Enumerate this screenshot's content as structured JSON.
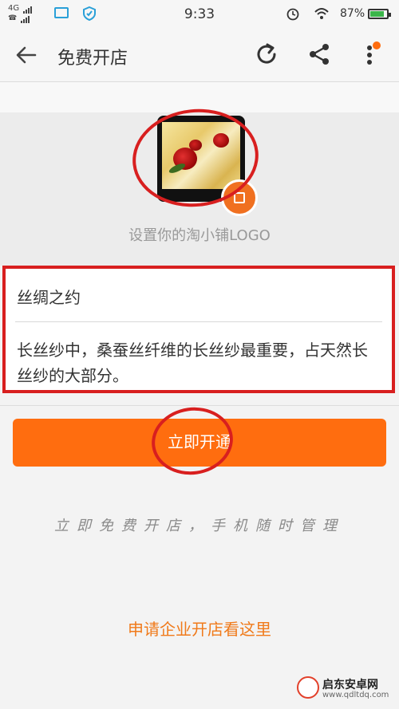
{
  "status_bar": {
    "network": "4G",
    "time": "9:33",
    "battery_percent": "87%",
    "battery_level": 0.87,
    "icons": [
      "signal-icon",
      "gallery-icon",
      "shield-icon",
      "alarm-icon",
      "wifi-icon",
      "battery-icon"
    ]
  },
  "header": {
    "title": "免费开店",
    "icons": [
      "back-arrow-icon",
      "refresh-icon",
      "share-icon",
      "more-icon"
    ],
    "notification_dot_color": "#ff6d0f"
  },
  "logo": {
    "caption": "设置你的淘小铺LOGO",
    "badge_icon": "edit-icon"
  },
  "form": {
    "shop_name": "丝绸之约",
    "shop_description": "长丝纱中，桑蚕丝纤维的长丝纱最重要，占天然长丝纱的大部分。"
  },
  "actions": {
    "open_button": "立即开通",
    "slogan": "立即免费开店，手机随时管理",
    "enterprise_link": "申请企业开店看这里"
  },
  "watermark": {
    "name": "启东安卓网",
    "url": "www.qdltdq.com"
  },
  "colors": {
    "accent": "#ff6d0f",
    "annotation_red": "#d81f1f",
    "link": "#f07a1a"
  }
}
